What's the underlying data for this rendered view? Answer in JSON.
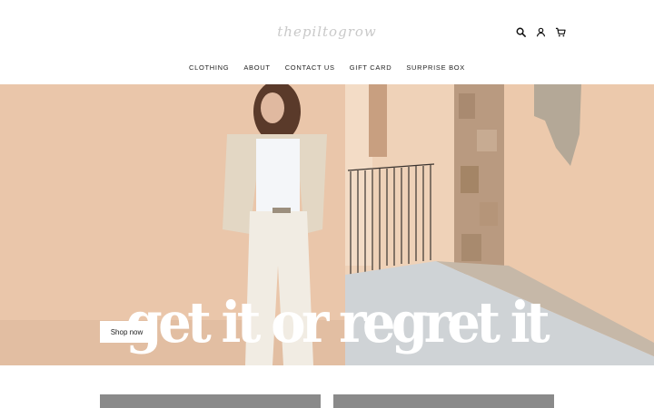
{
  "header": {
    "logo_text": "thepiltogrow",
    "icons": [
      "search-icon",
      "account-icon",
      "cart-icon"
    ]
  },
  "nav": {
    "items": [
      {
        "label": "CLOTHING"
      },
      {
        "label": "ABOUT"
      },
      {
        "label": "CONTACT US"
      },
      {
        "label": "GIFT CARD"
      },
      {
        "label": "SURPRISE BOX"
      }
    ]
  },
  "hero": {
    "heading": "get it or regret it",
    "cta_label": "Shop now"
  },
  "colors": {
    "accent": "#222222",
    "hero_wall": "#e9c7ac",
    "card_gray": "#8a8a8a"
  }
}
